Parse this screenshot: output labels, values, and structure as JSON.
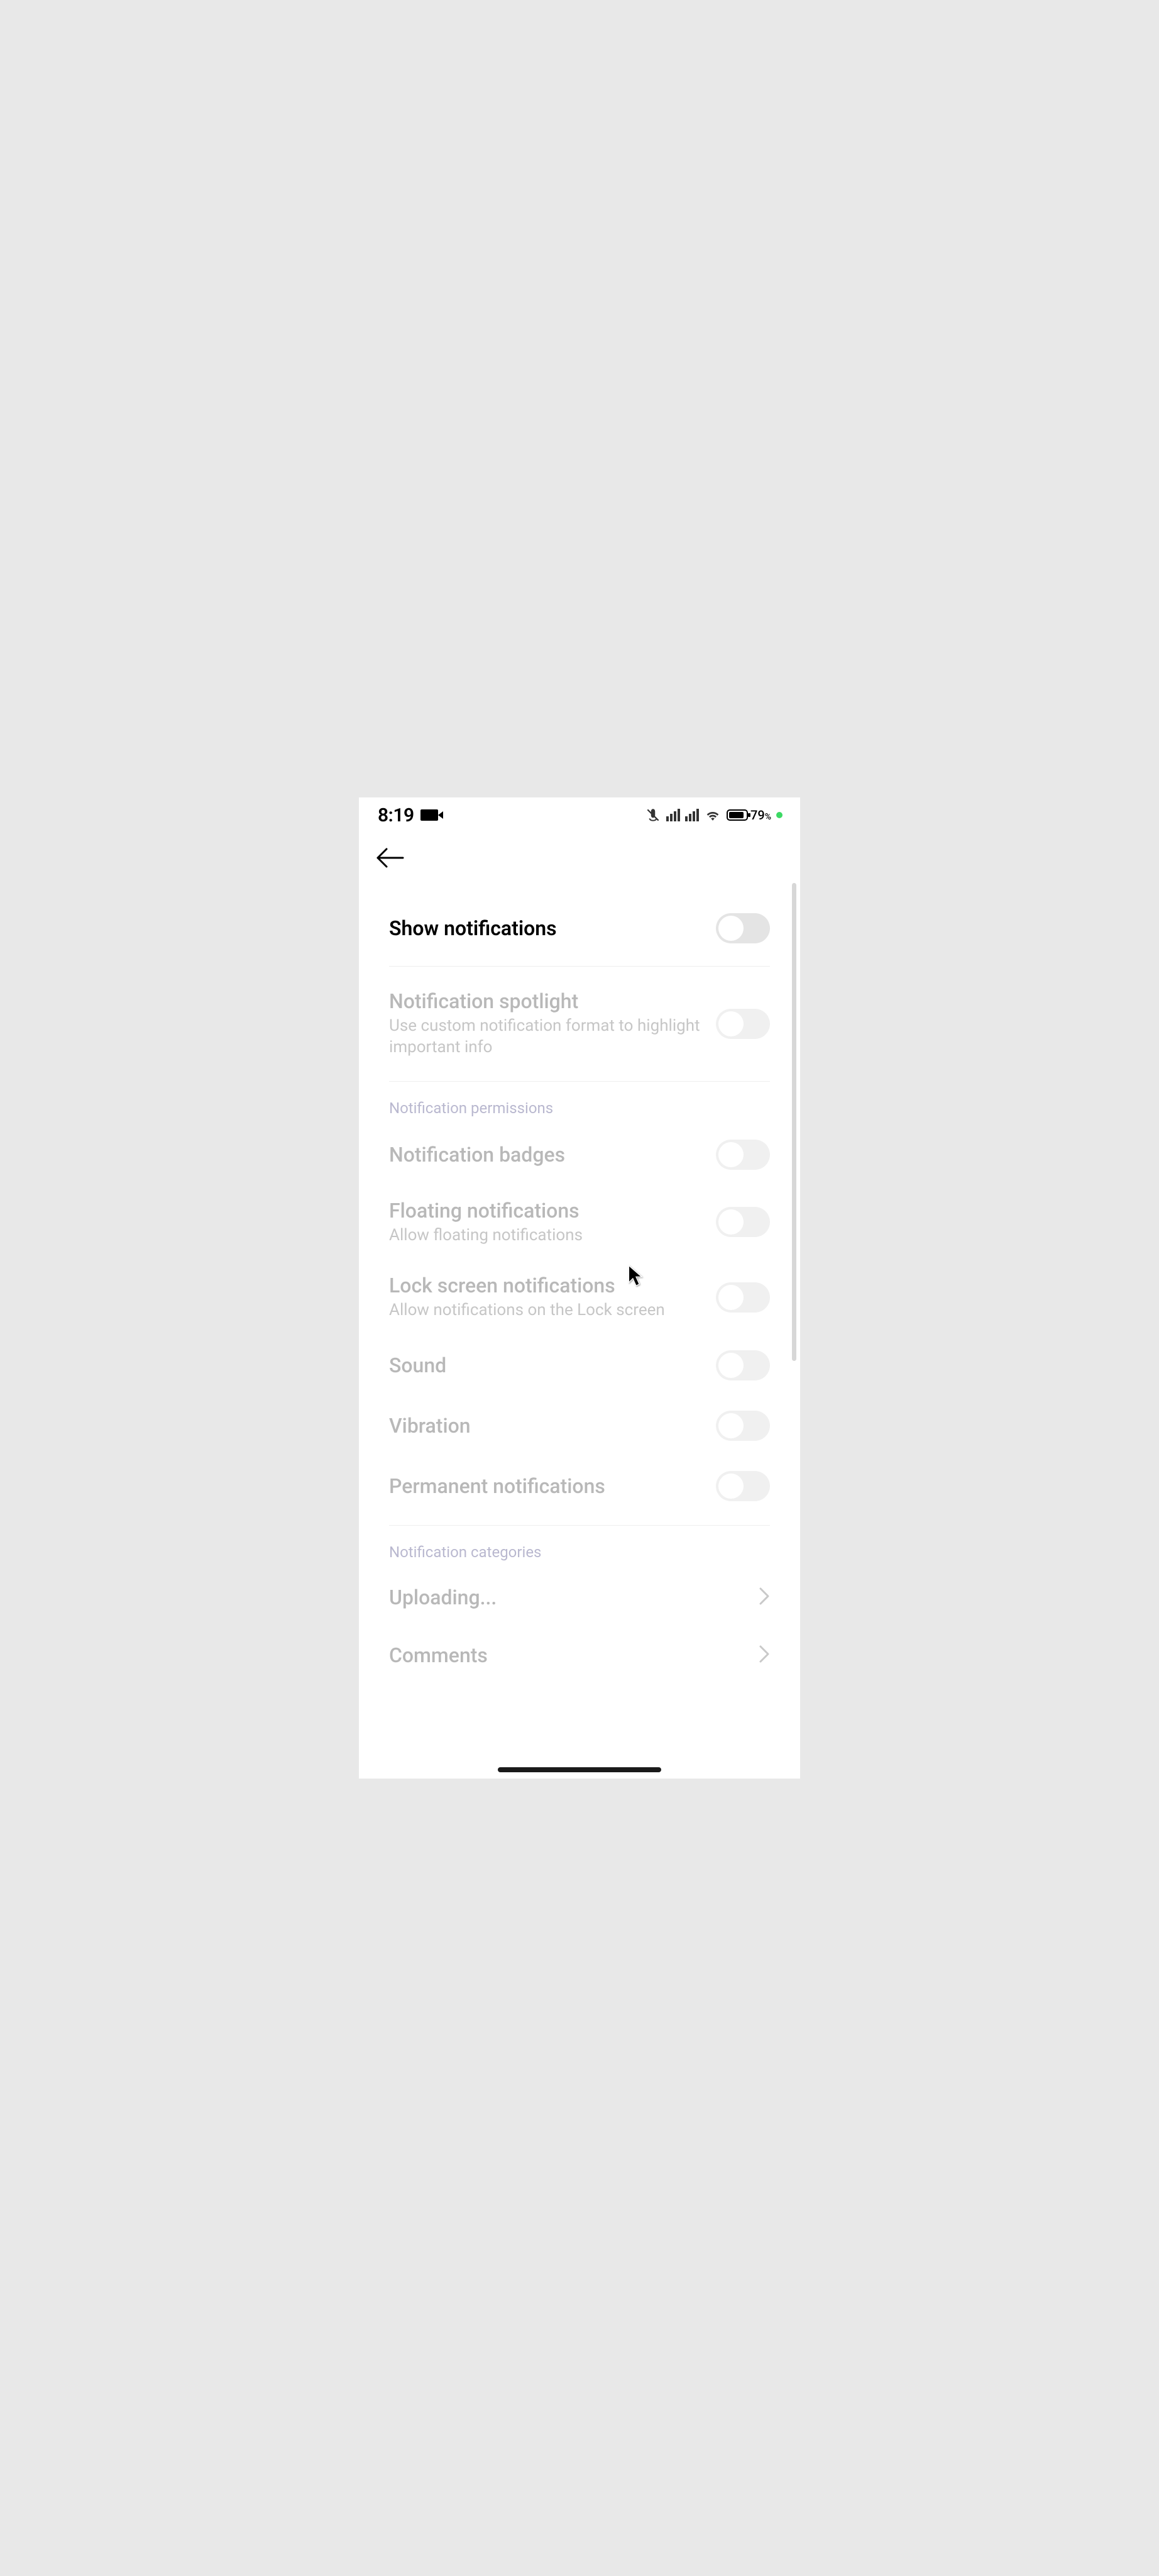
{
  "status_bar": {
    "time": "8:19",
    "battery_pct": "79",
    "battery_pct_suffix": "%"
  },
  "toolbar": {
    "back_label": "Back"
  },
  "main_toggle": {
    "title": "Show notifications"
  },
  "spotlight": {
    "title": "Notification spotlight",
    "subtitle": "Use custom notification format to highlight important info"
  },
  "permissions_header": "Notification permissions",
  "permissions": [
    {
      "title": "Notification badges",
      "subtitle": ""
    },
    {
      "title": "Floating notifications",
      "subtitle": "Allow floating notifications"
    },
    {
      "title": "Lock screen notifications",
      "subtitle": "Allow notifications on the Lock screen"
    },
    {
      "title": "Sound",
      "subtitle": ""
    },
    {
      "title": "Vibration",
      "subtitle": ""
    },
    {
      "title": "Permanent notifications",
      "subtitle": ""
    }
  ],
  "categories_header": "Notification categories",
  "categories": [
    {
      "title": "Uploading..."
    },
    {
      "title": "Comments"
    }
  ]
}
